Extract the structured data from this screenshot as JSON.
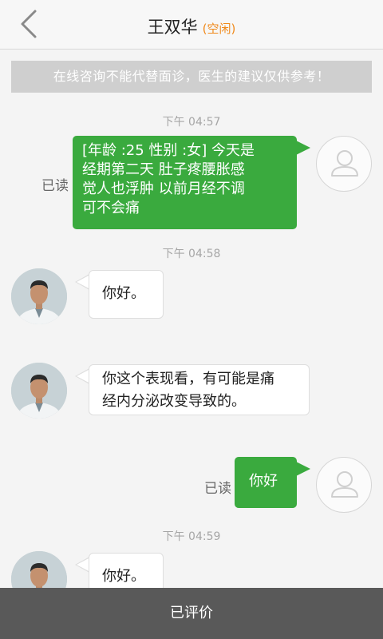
{
  "header": {
    "title": "王双华",
    "status": "(空闲)"
  },
  "notice": "在线咨询不能代替面诊，医生的建议仅供参考！",
  "messages": [
    {
      "time": "下午 04:57",
      "from": "user",
      "read": "已读",
      "lines": [
        "[年龄 :25 性别 :女]   今天是",
        "经期第二天  肚子疼腰胀感",
        "觉人也浮肿  以前月经不调",
        "可不会痛"
      ]
    },
    {
      "time": "下午 04:58",
      "from": "doctor",
      "lines": [
        "你好。"
      ]
    },
    {
      "from": "doctor",
      "lines": [
        "你这个表现看，有可能是痛",
        "经内分泌改变导致的。"
      ]
    },
    {
      "from": "user",
      "read": "已读",
      "lines": [
        "你好"
      ]
    },
    {
      "time": "下午 04:59",
      "from": "doctor",
      "lines": [
        "你好。"
      ]
    }
  ],
  "footer": {
    "label": "已评价"
  },
  "colors": {
    "accent_green": "#3aaa3e",
    "status_orange": "#f08a1c",
    "footer_bg": "#595959"
  }
}
